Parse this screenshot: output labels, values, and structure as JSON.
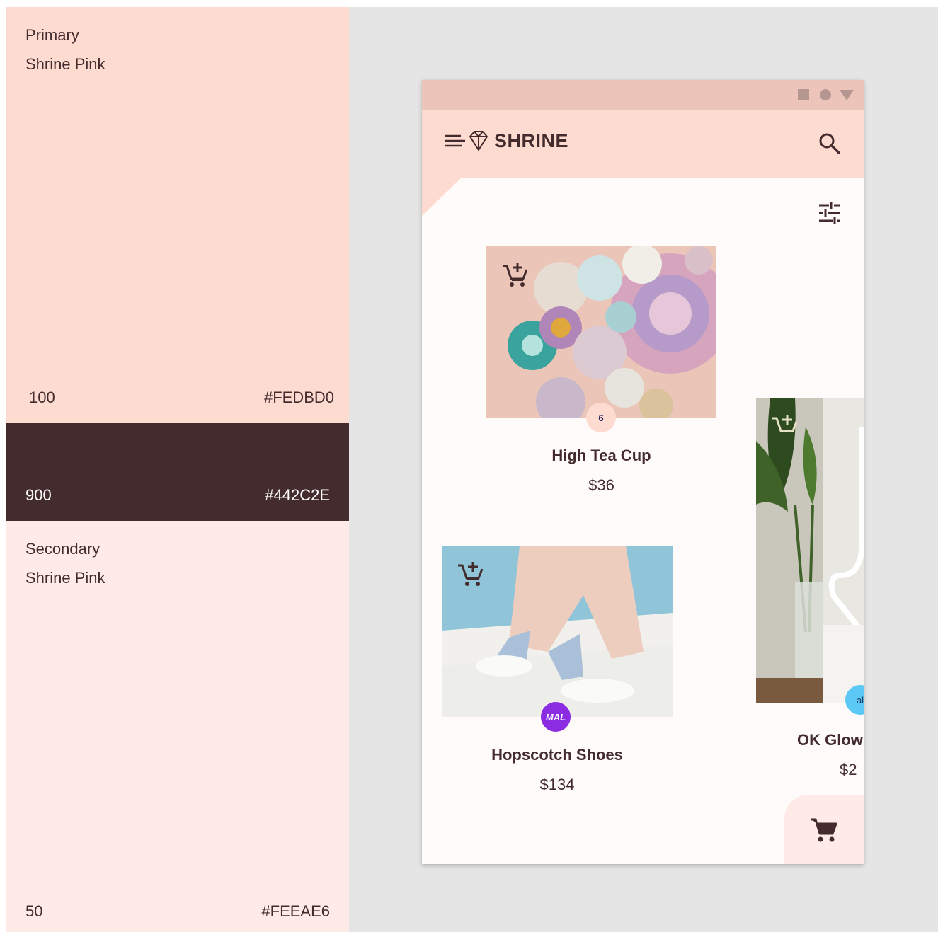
{
  "palette": {
    "primary": {
      "title": "Primary",
      "subtitle": "Shrine Pink",
      "shade": "100",
      "hex": "#FEDBD0"
    },
    "dark": {
      "shade": "900",
      "hex": "#442C2E"
    },
    "secondary": {
      "title": "Secondary",
      "subtitle": "Shrine Pink",
      "shade": "50",
      "hex": "#FEEAE6"
    }
  },
  "app": {
    "title": "SHRINE",
    "icons": {
      "status": [
        "square-icon",
        "circle-icon",
        "triangle-icon"
      ],
      "menu": "menu-icon",
      "logo": "diamond-logo-icon",
      "search": "search-icon",
      "filter": "tune-icon",
      "cart": "shopping-cart-icon"
    },
    "products": [
      {
        "name": "High Tea Cup",
        "price": "$36",
        "vendor_badge": "6",
        "vendor_color": "#FEDBD0"
      },
      {
        "name": "Hopscotch Shoes",
        "price": "$134",
        "vendor_badge": "MAL",
        "vendor_color": "#8B2BE2"
      },
      {
        "name": "OK Glow",
        "price": "$2",
        "vendor_badge": "al",
        "vendor_color": "#5BC8F5"
      }
    ]
  }
}
